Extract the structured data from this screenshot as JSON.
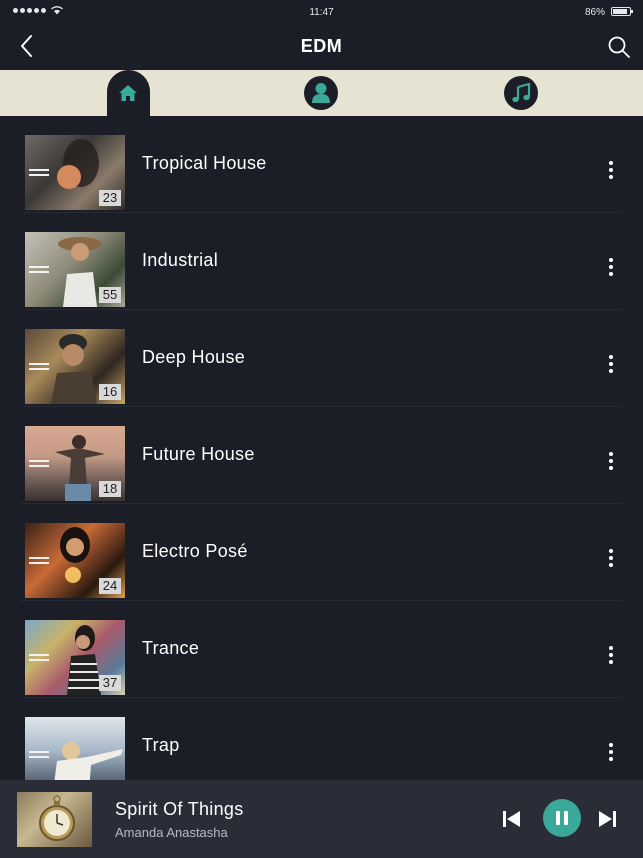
{
  "status_bar": {
    "time": "11:47",
    "battery": "86%"
  },
  "header": {
    "title": "EDM"
  },
  "tabs": [
    {
      "icon": "home-icon",
      "active": true
    },
    {
      "icon": "profile-icon",
      "active": false
    },
    {
      "icon": "music-note-icon",
      "active": false
    }
  ],
  "playlists": [
    {
      "title": "Tropical House",
      "count": "23"
    },
    {
      "title": "Industrial",
      "count": "55"
    },
    {
      "title": "Deep House",
      "count": "16"
    },
    {
      "title": "Future House",
      "count": "18"
    },
    {
      "title": "Electro Posé",
      "count": "24"
    },
    {
      "title": "Trance",
      "count": "37"
    },
    {
      "title": "Trap",
      "count": ""
    }
  ],
  "player": {
    "title": "Spirit Of Things",
    "artist": "Amanda Anastasha"
  },
  "colors": {
    "accent": "#3ba99a",
    "tab_bar": "#e6e3d3",
    "background": "#1b1e27",
    "player_bg": "#2a2d38"
  }
}
